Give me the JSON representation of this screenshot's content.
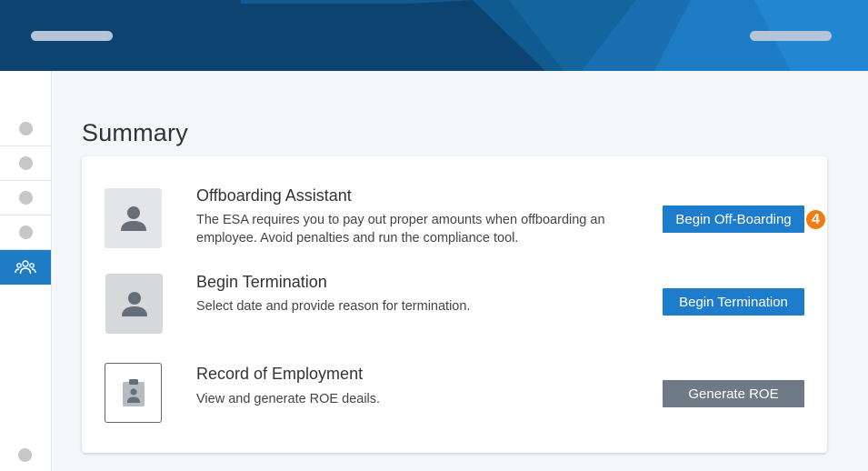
{
  "page": {
    "title": "Summary"
  },
  "sidebar": {
    "items": [
      {
        "icon": "placeholder-dot"
      },
      {
        "icon": "placeholder-dot"
      },
      {
        "icon": "placeholder-dot"
      },
      {
        "icon": "placeholder-dot"
      },
      {
        "icon": "people-icon",
        "active": true
      }
    ]
  },
  "rows": [
    {
      "icon": "person-icon",
      "title": "Offboarding Assistant",
      "description": "The ESA requires you to pay out proper amounts when offboarding an employee. Avoid penalties and run the compliance tool.",
      "button": "Begin Off-Boarding"
    },
    {
      "icon": "person-icon",
      "title": "Begin Termination",
      "description": "Select date and provide reason for termination.",
      "button": "Begin Termination"
    },
    {
      "icon": "clipboard-person-icon",
      "title": "Record of Employment",
      "description": "View and generate ROE deails.",
      "button": "Generate ROE"
    }
  ],
  "badge": {
    "step": "4"
  },
  "colors": {
    "header": "#0e4a7b",
    "accent_blue": "#1e7ccc",
    "disabled_grey": "#6e7b87",
    "badge_orange": "#ef7d13"
  }
}
